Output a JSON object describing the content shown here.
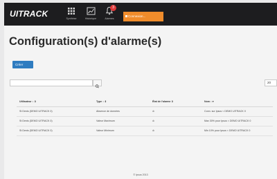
{
  "navbar": {
    "logo": "UITRACK",
    "items": [
      {
        "label": "Synthèse",
        "icon": "grid-icon"
      },
      {
        "label": "Historique",
        "icon": "chart-icon"
      },
      {
        "label": "Alarmes",
        "icon": "bell-icon"
      }
    ],
    "alarm_badge": "3",
    "connect_label": "Connexion..."
  },
  "page": {
    "title": "Configuration(s) d'alarme(s)",
    "create_label": "Créer",
    "search_placeholder": "",
    "page_size": "20"
  },
  "table": {
    "columns": [
      "Utilisateur ↕ ⇕",
      "Type ↕ ⇕",
      "État de l'alarme ⇕",
      "Nom ↕ ▾"
    ],
    "rows": [
      [
        "St Denis (DEMO UITRACK 0)",
        "Absence de données",
        "⊘",
        "Conn. sur Ipsus < DEMO UITRACK 0"
      ],
      [
        "St Denis (DEMO UITRACK 0)",
        "Valeur Maximum",
        "⊘",
        "Max 30% pour Ipsus < DEMO UITRACK 0"
      ],
      [
        "St Denis (DEMO UITRACK 0)",
        "Valeur Minimum",
        "⊘",
        "Min 10% pour Ipsus < DEMO UITRACK 0"
      ]
    ]
  },
  "footer": {
    "text": "© Ipsus 2013"
  },
  "colors": {
    "navbar": "#1d1d1f",
    "connect": "#f08c2b",
    "primary": "#2f7cc0",
    "badge": "#e03a3a"
  }
}
